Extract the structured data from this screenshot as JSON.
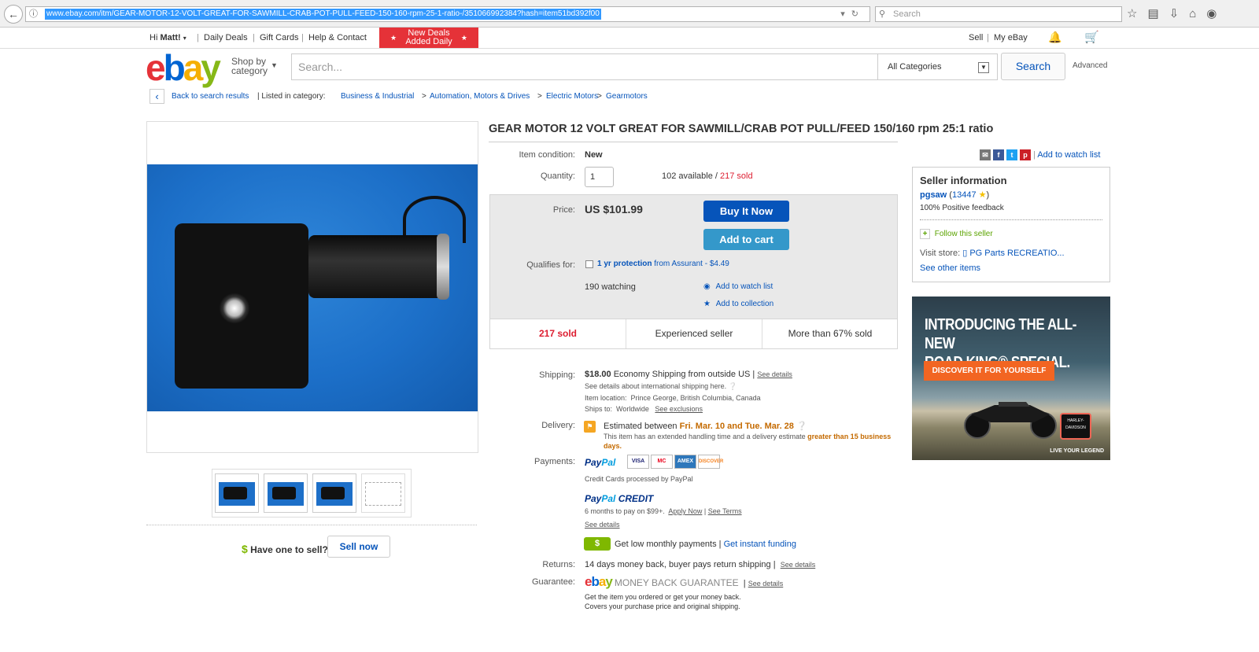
{
  "browser": {
    "back": "←",
    "url": "www.ebay.com/itm/GEAR-MOTOR-12-VOLT-GREAT-FOR-SAWMILL-CRAB-POT-PULL-FEED-150-160-rpm-25-1-ratio-/351066992384?hash=item51bd392f00",
    "search_placeholder": "Search"
  },
  "topnav": {
    "greeting": "Hi",
    "user": "Matt!",
    "daily_deals": "Daily Deals",
    "gift_cards": "Gift Cards",
    "help": "Help & Contact",
    "deal_banner_line1": "New Deals",
    "deal_banner_line2": "Added Daily",
    "sell": "Sell",
    "my_ebay": "My eBay"
  },
  "header": {
    "shop_by": "Shop by",
    "category": "category",
    "search_placeholder": "Search...",
    "category_select": "All Categories",
    "search_button": "Search",
    "advanced": "Advanced"
  },
  "breadcrumb": {
    "back": "Back to search results",
    "listed_in": "| Listed in category:",
    "items": [
      "Business & Industrial",
      "Automation, Motors & Drives",
      "Electric Motors",
      "Gearmotors"
    ],
    "sep": ">"
  },
  "listing": {
    "title": "GEAR MOTOR 12 VOLT GREAT FOR SAWMILL/CRAB POT PULL/FEED 150/160 rpm 25:1 ratio",
    "condition_label": "Item condition:",
    "condition": "New",
    "quantity_label": "Quantity:",
    "quantity": "1",
    "available": "102 available /",
    "sold": "217 sold",
    "price_label": "Price:",
    "price": "US $101.99",
    "buy_now": "Buy It Now",
    "add_to_cart": "Add to cart",
    "qualifies_label": "Qualifies for:",
    "protection": "1 yr protection",
    "protection_rest": "from Assurant - $4.49",
    "watching": "190 watching",
    "add_watch": "Add to watch list",
    "add_collection": "Add to collection",
    "stat_sold": "217 sold",
    "stat_seller": "Experienced seller",
    "stat_pct": "More than 67% sold"
  },
  "shipping": {
    "label": "Shipping:",
    "cost": "$18.00",
    "method": "Economy Shipping from outside US |",
    "see_details": "See details",
    "intl": "See details about international shipping here.",
    "location_label": "Item location:",
    "location": "Prince George, British Columbia, Canada",
    "ships_label": "Ships to:",
    "ships_to": "Worldwide",
    "exclusions": "See exclusions"
  },
  "delivery": {
    "label": "Delivery:",
    "estimated": "Estimated between",
    "dates": "Fri. Mar. 10 and Tue. Mar. 28",
    "note": "This item has an extended handling time and a delivery estimate",
    "note_hl": "greater than 15 business days."
  },
  "payments": {
    "label": "Payments:",
    "paypal_a": "Pay",
    "paypal_b": "Pal",
    "cards": [
      "VISA",
      "MC",
      "AMEX",
      "DISCOVER"
    ],
    "processed": "Credit Cards processed by PayPal",
    "credit": "CREDIT",
    "credit_terms": "6 months to pay on $99+.",
    "apply_now": "Apply Now",
    "see_terms": "See Terms",
    "see_details": "See details",
    "low_monthly": "Get low monthly payments |",
    "instant": "Get instant funding"
  },
  "returns": {
    "label": "Returns:",
    "text": "14 days money back, buyer pays return shipping |",
    "see_details": "See details"
  },
  "guarantee": {
    "label": "Guarantee:",
    "mbg": "MONEY BACK GUARANTEE",
    "see_details": "See details",
    "line1": "Get the item you ordered or get your money back.",
    "line2": "Covers your purchase price and original shipping."
  },
  "left": {
    "have_one": "Have one to sell?",
    "sell_now": "Sell now"
  },
  "share": {
    "add_watch": "Add to watch list"
  },
  "seller": {
    "heading": "Seller information",
    "name": "pgsaw",
    "score": "13447",
    "feedback": "100% Positive feedback",
    "follow": "Follow this seller",
    "visit_label": "Visit store:",
    "store": "PG Parts RECREATIO...",
    "other": "See other items"
  },
  "ad": {
    "line1": "INTRODUCING THE ALL-NEW",
    "line2": "ROAD KING® SPECIAL.",
    "cta": "DISCOVER IT FOR YOURSELF",
    "legend": "LIVE YOUR LEGEND",
    "logo": "HARLEY-DAVIDSON"
  }
}
